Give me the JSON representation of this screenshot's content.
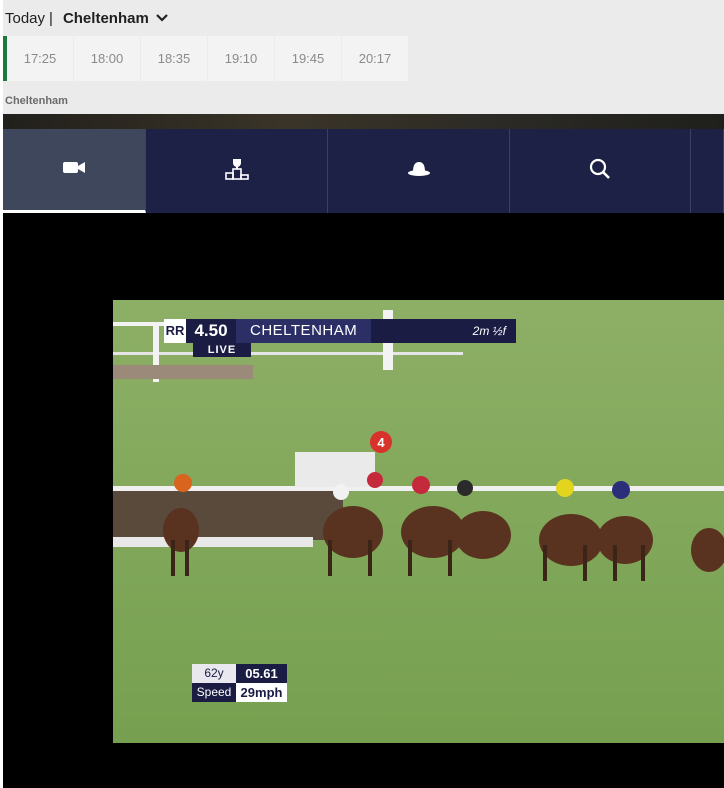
{
  "header": {
    "day": "Today",
    "separator": "|",
    "venue": "Cheltenham"
  },
  "race_times": [
    "17:25",
    "18:00",
    "18:35",
    "19:10",
    "19:45",
    "20:17"
  ],
  "selected_time_index": 0,
  "track_label": "Cheltenham",
  "nav": {
    "tabs": [
      {
        "icon": "video-camera-icon",
        "active": true
      },
      {
        "icon": "trophy-podium-icon",
        "active": false
      },
      {
        "icon": "jockey-hat-icon",
        "active": false
      },
      {
        "icon": "search-icon",
        "active": false
      }
    ]
  },
  "video_overlay": {
    "logo": "RR",
    "race_time": "4.50",
    "course": "CHELTENHAM",
    "distance": "2m ½f",
    "status": "LIVE",
    "yards_label": "62y",
    "elapsed": "05.61",
    "speed_label": "Speed",
    "speed_value": "29mph",
    "marker_number": "4"
  },
  "colors": {
    "nav_bg": "#1d2145",
    "nav_active": "#3e475c",
    "active_time_marker": "#1c7a3a",
    "grass": "#7fa05a"
  }
}
